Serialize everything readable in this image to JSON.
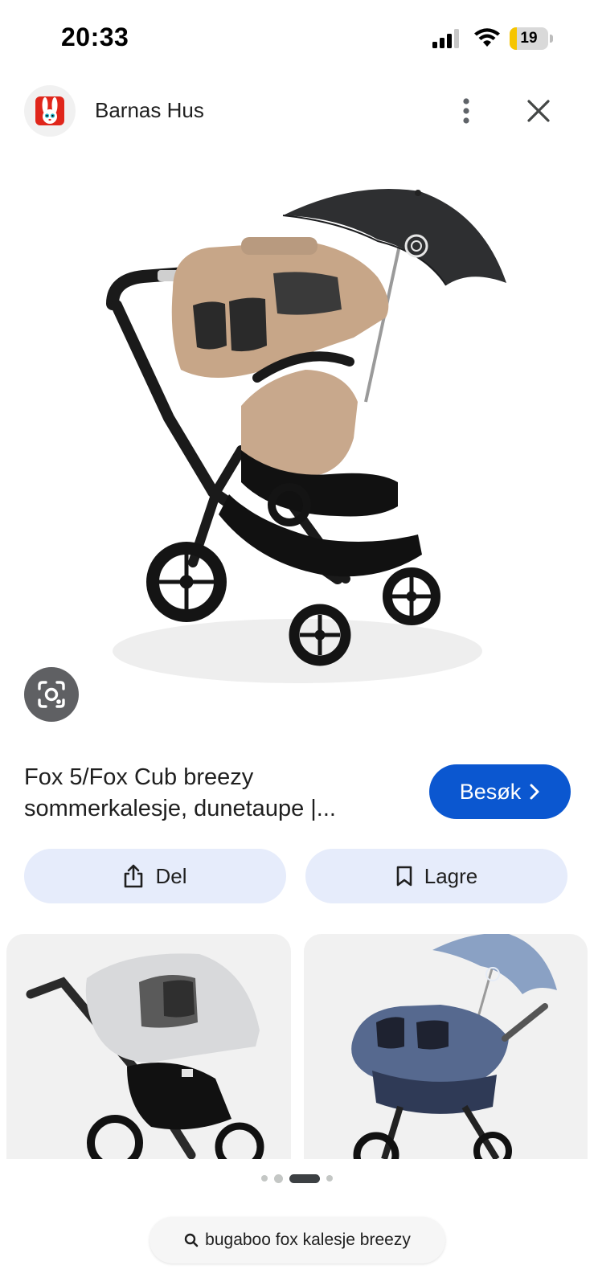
{
  "status_bar": {
    "time": "20:33",
    "battery_level": "19",
    "battery_fraction": 0.19,
    "battery_color": "#f6c500"
  },
  "header": {
    "site_name": "Barnas Hus",
    "logo_icon": "bunny-logo-icon",
    "more_icon": "more-vert-icon",
    "close_icon": "close-icon"
  },
  "hero": {
    "image": "stroller-with-umbrella-image",
    "lens_icon": "google-lens-icon"
  },
  "result": {
    "title": "Fox 5/Fox Cub breezy sommerkalesje, dunetaupe |...",
    "visit_label": "Besøk",
    "visit_icon": "chevron-right-icon",
    "accent_color": "#0b57d0"
  },
  "actions": {
    "share_label": "Del",
    "share_icon": "share-icon",
    "save_label": "Lagre",
    "save_icon": "bookmark-icon"
  },
  "related": [
    {
      "image": "grey-breezy-canopy-stroller-image"
    },
    {
      "image": "blue-carrycot-stroller-umbrella-image"
    }
  ],
  "pagination": {
    "dot_count": 4,
    "active_index": 2
  },
  "search": {
    "query": "bugaboo fox kalesje breezy",
    "icon": "search-icon"
  }
}
